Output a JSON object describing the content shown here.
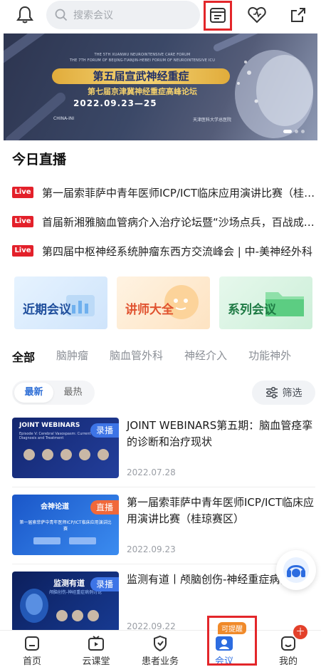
{
  "search": {
    "placeholder": "搜索会议"
  },
  "banner": {
    "line_en_1": "THE 5TH XUANWU NEUROINTENSIVE CARE FORUM",
    "line_en_2": "THE 7TH FORUM OF BEIJING-TIANJIN-HEBEI FORUM OF NEUROINTENSIVE ICU",
    "title": "第五届宣武神经重症",
    "subtitle": "第七届京津冀神经重症高峰论坛",
    "date": "2022.09.23—25",
    "logos": [
      "CHINA-INI",
      "天津医科大学总医院"
    ]
  },
  "live": {
    "section_title": "今日直播",
    "badge": "Live",
    "items": [
      "第一届索菲萨中青年医师ICP/ICT临床应用演讲比赛（桂琼赛区）",
      "首届新湘雅脑血管病介入治疗论坛暨“沙场点兵，百战成钢”",
      "第四届中枢神经系统肿瘤东西方交流峰会 | 中-美神经外科"
    ]
  },
  "categories": [
    {
      "label": "近期会议",
      "color": "#1f4e9c"
    },
    {
      "label": "讲师大全",
      "color": "#e0522f"
    },
    {
      "label": "系列会议",
      "color": "#1e7a44"
    }
  ],
  "tabs": [
    "全部",
    "脑肿瘤",
    "脑血管外科",
    "神经介入",
    "功能神外"
  ],
  "sort": {
    "latest": "最新",
    "hottest": "最热",
    "filter": "筛选"
  },
  "list": [
    {
      "tag": "录播",
      "title": "JOINT WEBINARS第五期：脑血管痉挛的诊断和治疗现状",
      "date": "2022.07.28",
      "thumb_title": "JOINT WEBINARS",
      "thumb_sub": "Episode V: Cerebral Vasospasm: Current Diagnosis and Treatment"
    },
    {
      "tag": "直播",
      "title": "第一届索菲萨中青年医师ICP/ICT临床应用演讲比赛（桂琼赛区）",
      "date": "2022.09.23",
      "thumb_title": "会神论道",
      "thumb_sub": "第一届索菲萨中青年医师ICP/ICT临床应用演讲比赛"
    },
    {
      "tag": "录播",
      "title": "监测有道丨颅脑创伤-神经重症病例讨论",
      "date": "2022.09.22",
      "thumb_title": "监测有道",
      "thumb_sub": "颅脑创伤-神经重症病例讨论"
    }
  ],
  "bottom_nav": {
    "items": [
      "首页",
      "云课堂",
      "患者业务",
      "会议",
      "我的"
    ],
    "reminder_badge": "可提醒",
    "mine_badge": "十"
  },
  "colors": {
    "accent": "#2c6ce0",
    "live_red": "#e3202a",
    "highlight_box": "#e3262a"
  }
}
